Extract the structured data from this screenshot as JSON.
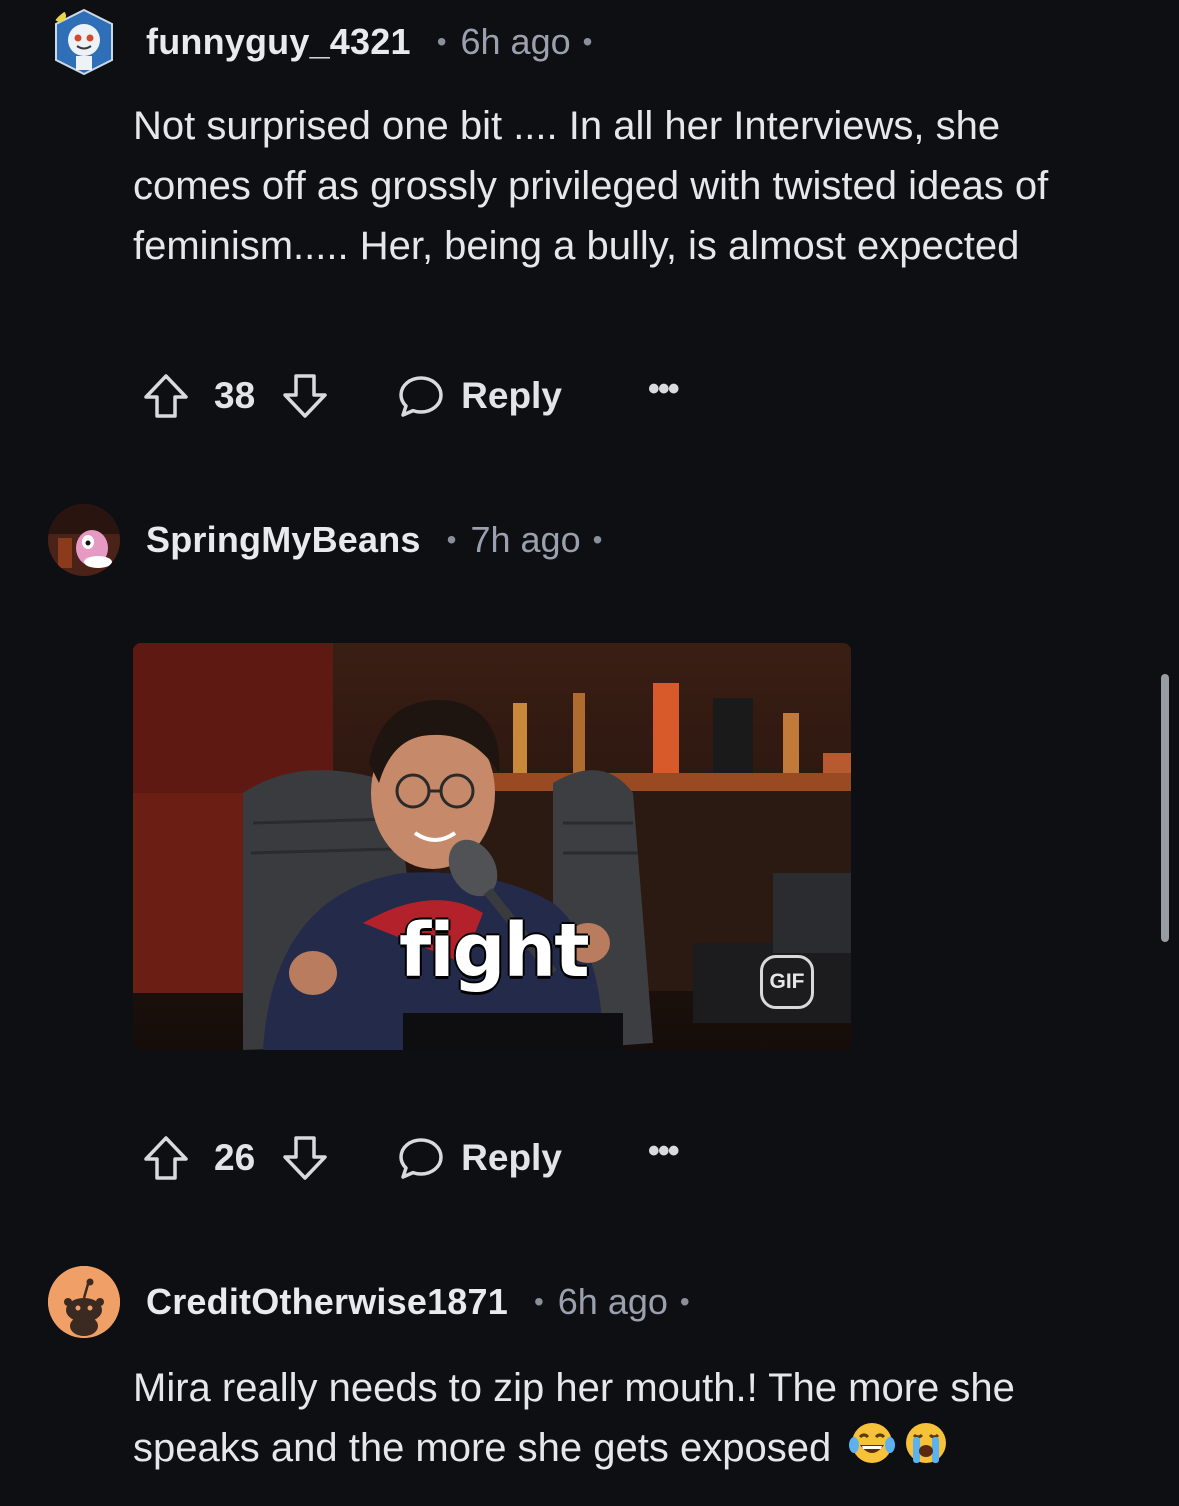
{
  "comments": [
    {
      "username": "funnyguy_4321",
      "separator": "•",
      "time": "6h ago",
      "text": "Not surprised one bit .... In all her Interviews, she comes off as grossly privileged with twisted ideas of feminism..... Her, being a bully, is almost expected",
      "score": "38",
      "reply_label": "Reply",
      "more_label": "•••"
    },
    {
      "username": "SpringMyBeans",
      "separator": "•",
      "time": "7h ago",
      "gif": {
        "caption": "fight",
        "badge": "GIF"
      },
      "score": "26",
      "reply_label": "Reply",
      "more_label": "•••"
    },
    {
      "username": "CreditOtherwise1871",
      "separator": "•",
      "time": "6h ago",
      "text": "Mira really needs to zip her mouth.! The more she speaks and the more she gets exposed",
      "emojis": [
        "laughing-tears-emoji",
        "crying-emoji"
      ]
    }
  ],
  "icons": {
    "upvote": "upvote-arrow-icon",
    "downvote": "downvote-arrow-icon",
    "reply": "speech-bubble-icon",
    "more": "ellipsis-icon"
  },
  "colors": {
    "background": "#0e0f13",
    "text": "#e6e7ea",
    "muted": "#9aa0ad"
  }
}
